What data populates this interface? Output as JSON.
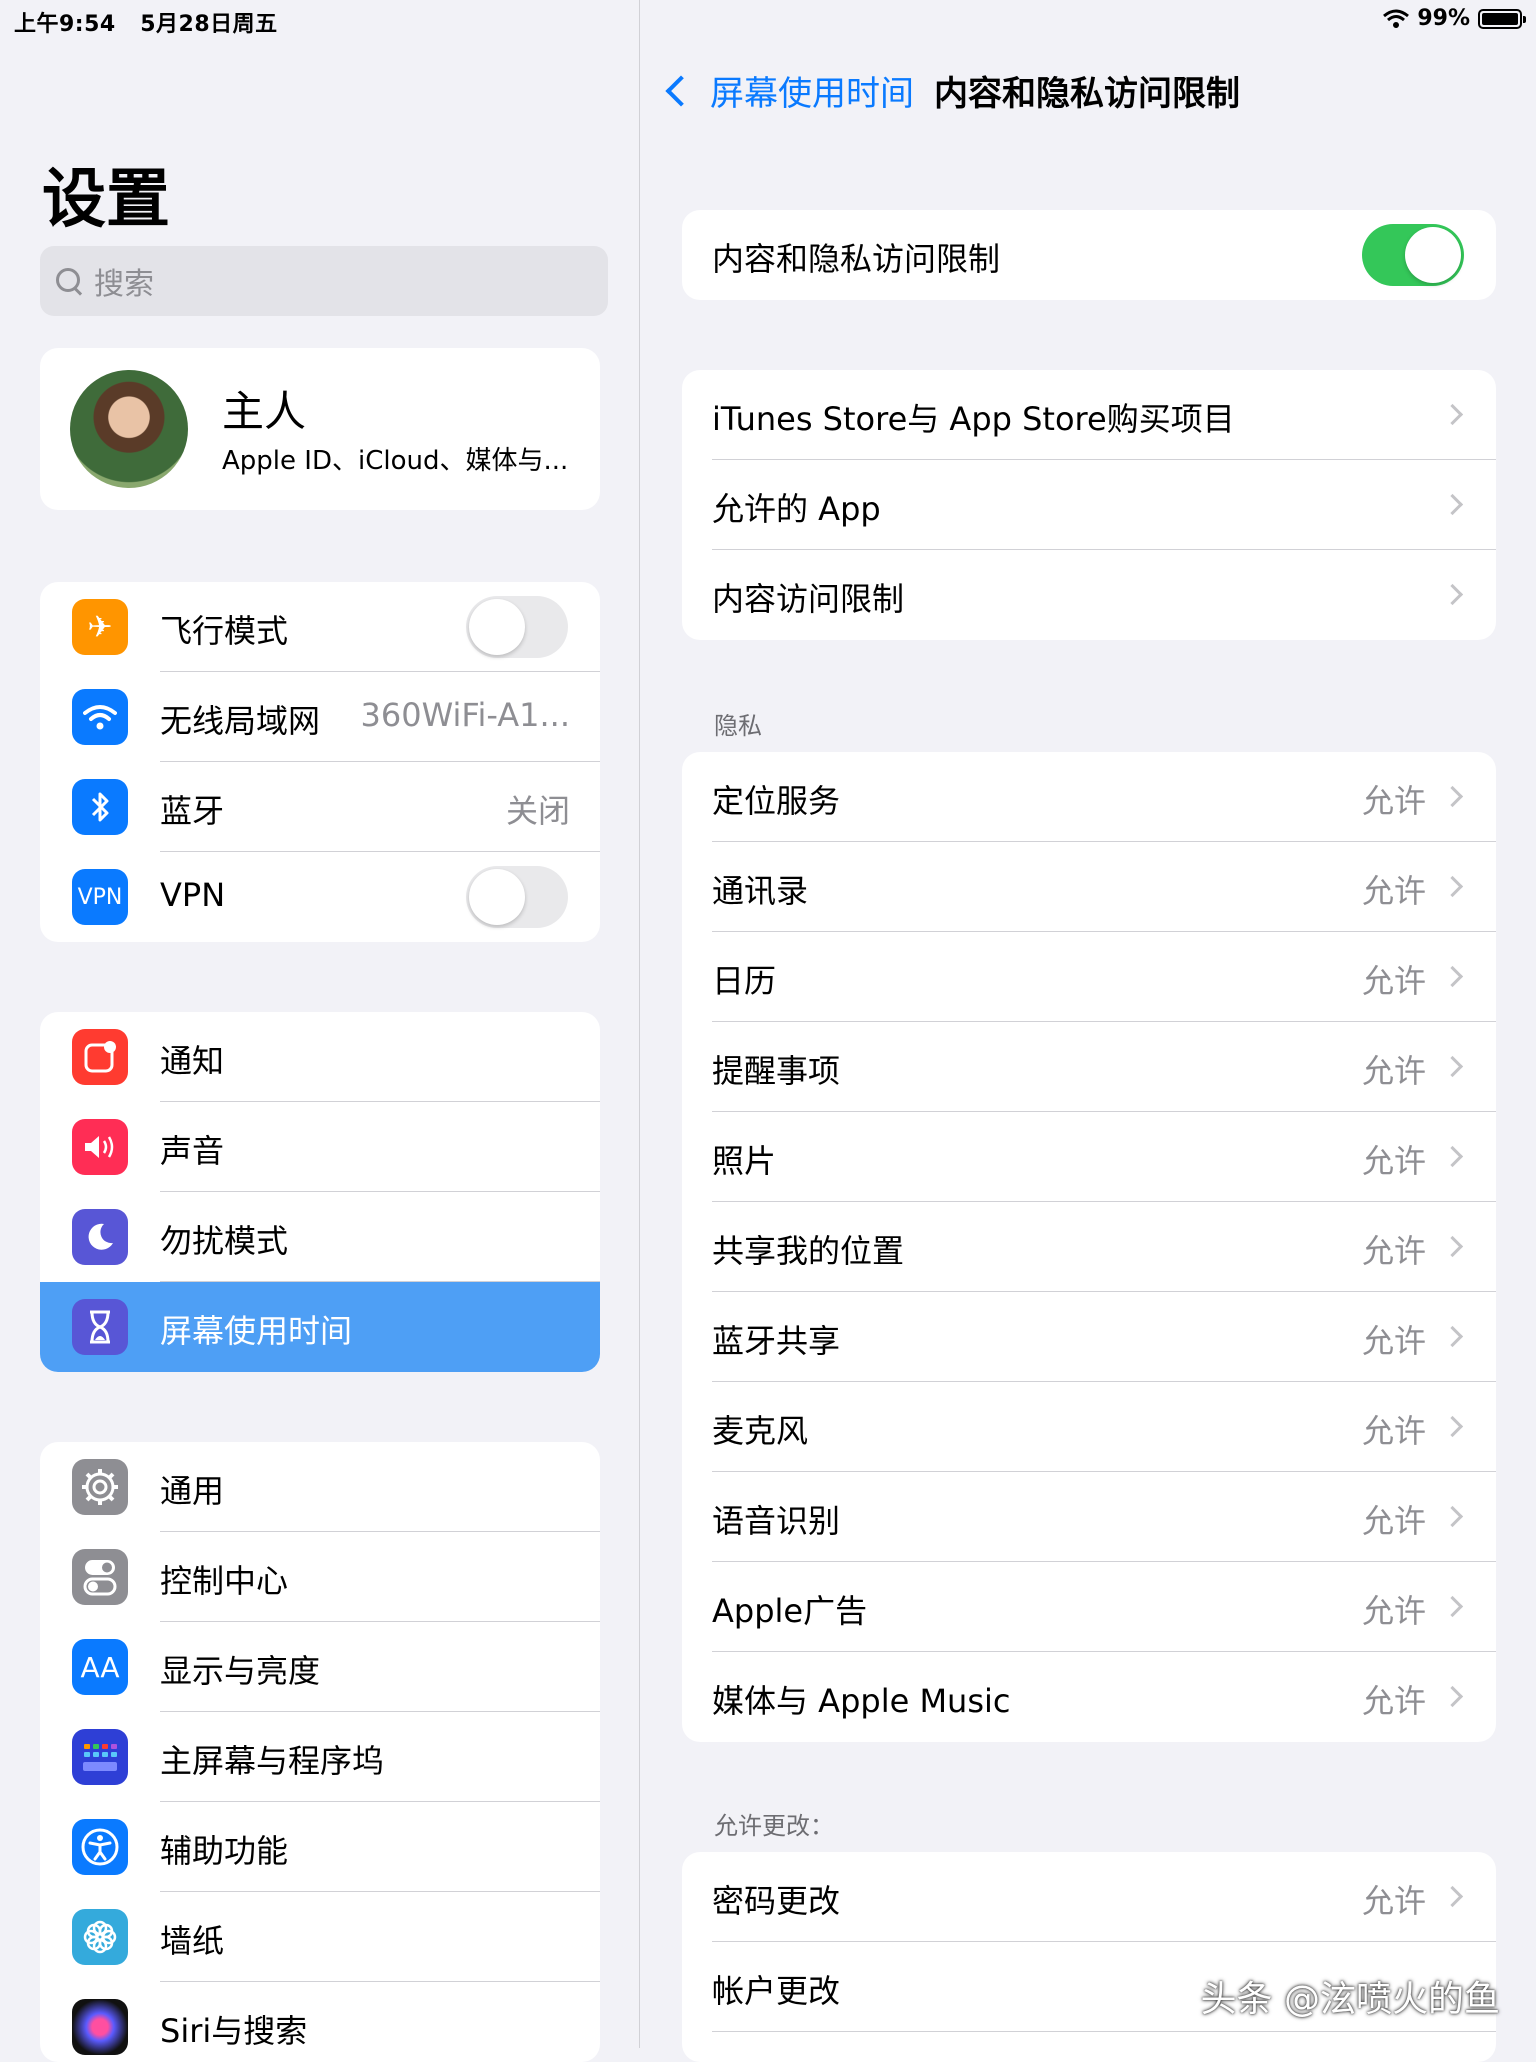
{
  "status": {
    "time": "上午9:54",
    "date": "5月28日周五",
    "battery": "99%"
  },
  "sidebar": {
    "title": "设置",
    "search_placeholder": "搜索",
    "profile": {
      "name": "主人",
      "subtitle": "Apple ID、iCloud、媒体与..."
    },
    "group1": [
      {
        "label": "飞行模式",
        "icon": "airplane-icon",
        "color": "#ff9500",
        "toggle": false
      },
      {
        "label": "无线局域网",
        "icon": "wifi-icon",
        "color": "#0a7aff",
        "value": "360WiFi-A1..."
      },
      {
        "label": "蓝牙",
        "icon": "bluetooth-icon",
        "color": "#0a7aff",
        "value": "关闭"
      },
      {
        "label": "VPN",
        "icon": "vpn-icon",
        "color": "#0a7aff",
        "icon_text": "VPN",
        "toggle": false
      }
    ],
    "group2": [
      {
        "label": "通知",
        "icon": "notification-icon",
        "color": "#ff3b30"
      },
      {
        "label": "声音",
        "icon": "sound-icon",
        "color": "#ff2d55"
      },
      {
        "label": "勿扰模式",
        "icon": "moon-icon",
        "color": "#5856d6"
      },
      {
        "label": "屏幕使用时间",
        "icon": "hourglass-icon",
        "color": "#5856d6",
        "selected": true
      }
    ],
    "group3": [
      {
        "label": "通用",
        "icon": "gear-icon",
        "color": "#8e8e93"
      },
      {
        "label": "控制中心",
        "icon": "control-center-icon",
        "color": "#8e8e93"
      },
      {
        "label": "显示与亮度",
        "icon": "display-icon",
        "color": "#0a7aff",
        "icon_text": "AA"
      },
      {
        "label": "主屏幕与程序坞",
        "icon": "home-screen-icon",
        "color": "#2e3fd6"
      },
      {
        "label": "辅助功能",
        "icon": "accessibility-icon",
        "color": "#0a7aff"
      },
      {
        "label": "墙纸",
        "icon": "wallpaper-icon",
        "color": "#34aadc"
      },
      {
        "label": "Siri与搜索",
        "icon": "siri-icon",
        "color": "#222"
      }
    ]
  },
  "detail": {
    "back_label": "屏幕使用时间",
    "title": "内容和隐私访问限制",
    "main_toggle": {
      "label": "内容和隐私访问限制",
      "on": true
    },
    "store_group": [
      {
        "label": "iTunes Store与 App Store购买项目"
      },
      {
        "label": "允许的 App"
      },
      {
        "label": "内容访问限制"
      }
    ],
    "privacy_header": "隐私",
    "privacy": [
      {
        "label": "定位服务",
        "value": "允许"
      },
      {
        "label": "通讯录",
        "value": "允许"
      },
      {
        "label": "日历",
        "value": "允许"
      },
      {
        "label": "提醒事项",
        "value": "允许"
      },
      {
        "label": "照片",
        "value": "允许"
      },
      {
        "label": "共享我的位置",
        "value": "允许"
      },
      {
        "label": "蓝牙共享",
        "value": "允许"
      },
      {
        "label": "麦克风",
        "value": "允许"
      },
      {
        "label": "语音识别",
        "value": "允许"
      },
      {
        "label": "Apple广告",
        "value": "允许"
      },
      {
        "label": "媒体与 Apple Music",
        "value": "允许"
      }
    ],
    "changes_header": "允许更改：",
    "changes": [
      {
        "label": "密码更改",
        "value": "允许"
      },
      {
        "label": "帐户更改",
        "value": ""
      }
    ]
  },
  "watermark": "头条 @泫喷火的鱼"
}
